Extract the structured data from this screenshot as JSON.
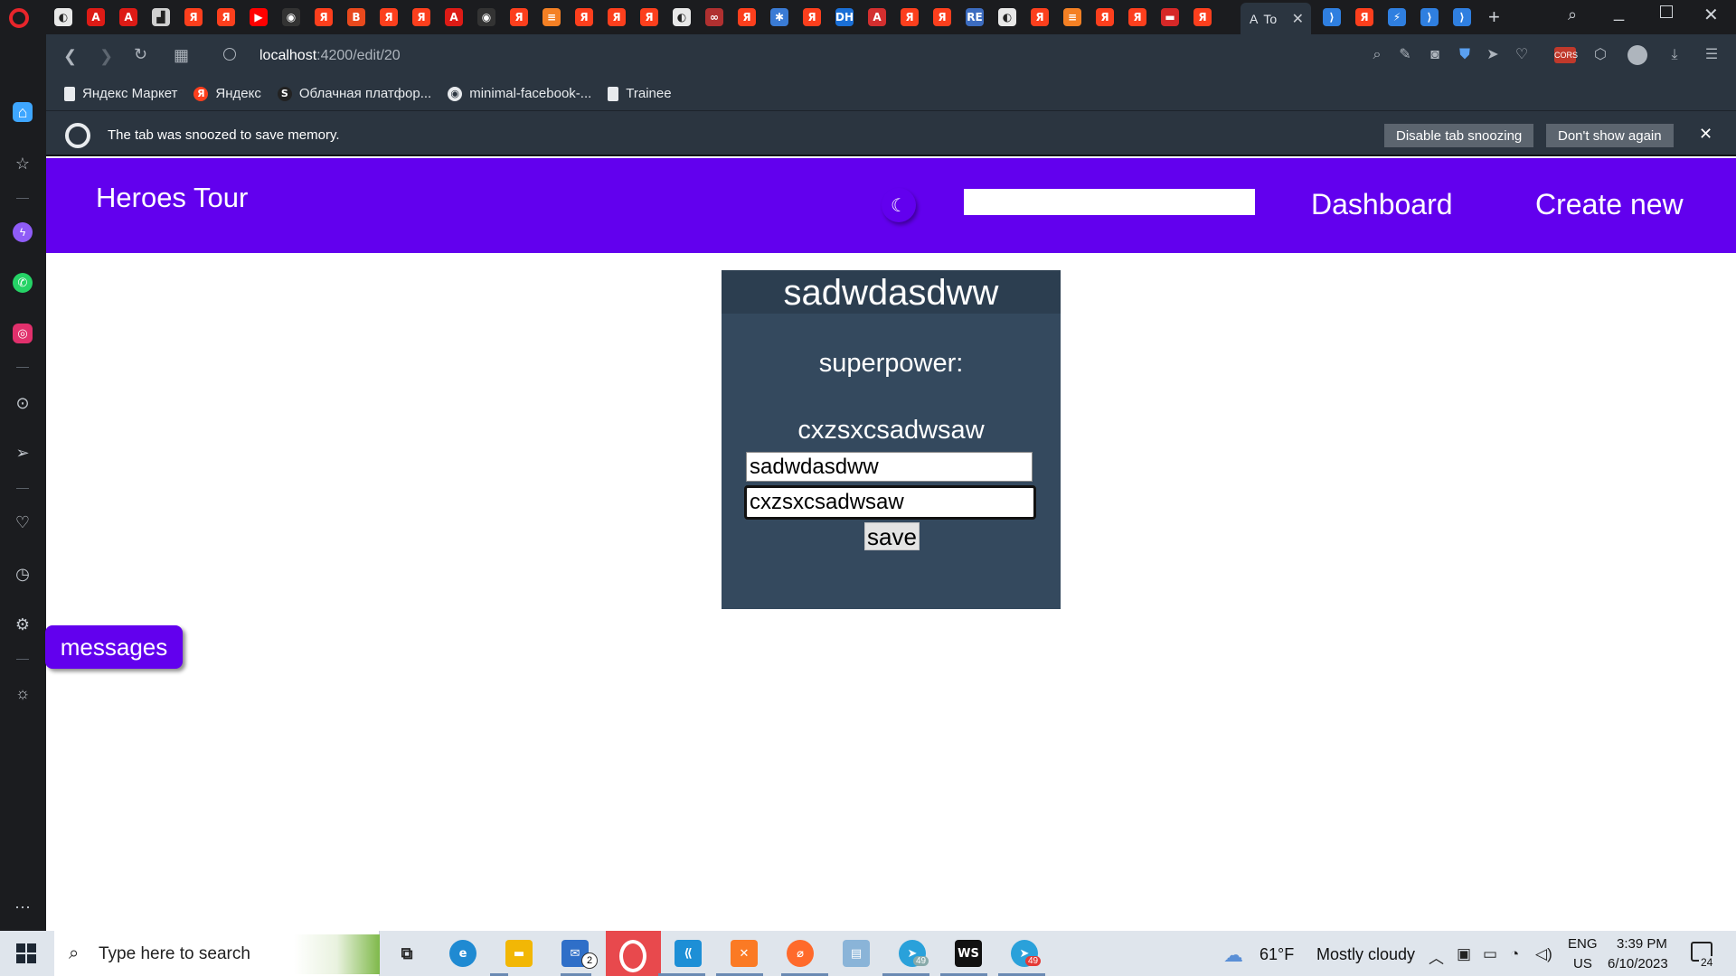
{
  "browser": {
    "tabs": [
      {
        "icon": "globe-icon",
        "color": "#e8e8e8",
        "glyph": "◐"
      },
      {
        "icon": "angular-icon",
        "color": "#dd1b16",
        "glyph": "A"
      },
      {
        "icon": "angular-icon",
        "color": "#dd1b16",
        "glyph": "A"
      },
      {
        "icon": "note-icon",
        "color": "#d0d0d0",
        "glyph": "▟"
      },
      {
        "icon": "yandex-icon",
        "color": "#fc3f1d",
        "glyph": "Я"
      },
      {
        "icon": "yandex-icon",
        "color": "#fc3f1d",
        "glyph": "Я"
      },
      {
        "icon": "youtube-icon",
        "color": "#ff0000",
        "glyph": "▶"
      },
      {
        "icon": "github-icon",
        "color": "#333333",
        "glyph": "◉"
      },
      {
        "icon": "yandex-icon",
        "color": "#fc3f1d",
        "glyph": "Я"
      },
      {
        "icon": "bold-icon",
        "color": "#e8491d",
        "glyph": "B"
      },
      {
        "icon": "yandex-icon",
        "color": "#fc3f1d",
        "glyph": "Я"
      },
      {
        "icon": "yandex-icon",
        "color": "#fc3f1d",
        "glyph": "Я"
      },
      {
        "icon": "angular-icon",
        "color": "#dd1b16",
        "glyph": "A"
      },
      {
        "icon": "github-icon",
        "color": "#333333",
        "glyph": "◉"
      },
      {
        "icon": "yandex-icon",
        "color": "#fc3f1d",
        "glyph": "Я"
      },
      {
        "icon": "stackoverflow-icon",
        "color": "#f48024",
        "glyph": "≡"
      },
      {
        "icon": "yandex-icon",
        "color": "#fc3f1d",
        "glyph": "Я"
      },
      {
        "icon": "yandex-icon",
        "color": "#fc3f1d",
        "glyph": "Я"
      },
      {
        "icon": "yandex-icon",
        "color": "#fc3f1d",
        "glyph": "Я"
      },
      {
        "icon": "globe-icon",
        "color": "#e8e8e8",
        "glyph": "◐"
      },
      {
        "icon": "infinity-icon",
        "color": "#b03030",
        "glyph": "∞"
      },
      {
        "icon": "yandex-icon",
        "color": "#fc3f1d",
        "glyph": "Я"
      },
      {
        "icon": "puzzle-icon",
        "color": "#3a7bd5",
        "glyph": "✱"
      },
      {
        "icon": "yandex-icon",
        "color": "#fc3f1d",
        "glyph": "Я"
      },
      {
        "icon": "dh-icon",
        "color": "#1a6fd6",
        "glyph": "DH"
      },
      {
        "icon": "pdf-icon",
        "color": "#d32f2f",
        "glyph": "A"
      },
      {
        "icon": "yandex-icon",
        "color": "#fc3f1d",
        "glyph": "Я"
      },
      {
        "icon": "yandex-icon",
        "color": "#fc3f1d",
        "glyph": "Я"
      },
      {
        "icon": "repo-icon",
        "color": "#3c6cc0",
        "glyph": "RE"
      },
      {
        "icon": "globe-icon",
        "color": "#e8e8e8",
        "glyph": "◐"
      },
      {
        "icon": "yandex-icon",
        "color": "#fc3f1d",
        "glyph": "Я"
      },
      {
        "icon": "stackoverflow-icon",
        "color": "#f48024",
        "glyph": "≡"
      },
      {
        "icon": "yandex-icon",
        "color": "#fc3f1d",
        "glyph": "Я"
      },
      {
        "icon": "yandex-icon",
        "color": "#fc3f1d",
        "glyph": "Я"
      },
      {
        "icon": "hud-icon",
        "color": "#d62828",
        "glyph": "▬"
      },
      {
        "icon": "yandex-icon",
        "color": "#fc3f1d",
        "glyph": "Я"
      }
    ],
    "active_tab": {
      "favicon": "A",
      "title": "To"
    },
    "tabs_after": [
      {
        "icon": "vscode-icon",
        "color": "#2f7fe0",
        "glyph": "⟩"
      },
      {
        "icon": "yandex-icon",
        "color": "#fc3f1d",
        "glyph": "Я"
      },
      {
        "icon": "bolt-icon",
        "color": "#2f7fe0",
        "glyph": "⚡"
      },
      {
        "icon": "vscode-icon",
        "color": "#2f7fe0",
        "glyph": "⟩"
      },
      {
        "icon": "vscode-icon",
        "color": "#2f7fe0",
        "glyph": "⟩"
      }
    ],
    "url_host": "localhost",
    "url_path": ":4200/edit/20",
    "bookmarks": [
      {
        "label": "Яндекс Маркет",
        "icon": "doc"
      },
      {
        "label": "Яндекс",
        "icon": "yandex"
      },
      {
        "label": "Облачная платфор...",
        "icon": "s"
      },
      {
        "label": "minimal-facebook-...",
        "icon": "github"
      },
      {
        "label": "Trainee",
        "icon": "doc"
      }
    ],
    "snooze": {
      "message": "The tab was snoozed to save memory.",
      "disable_label": "Disable tab snoozing",
      "dont_show_label": "Don't show again"
    }
  },
  "app": {
    "title": "Heroes Tour",
    "nav": {
      "dashboard": "Dashboard",
      "create": "Create new"
    },
    "hero": {
      "name": "sadwdasdww",
      "superpower_label": "superpower:",
      "superpower": "cxzsxcsadwsaw",
      "name_input_value": "sadwdasdww",
      "power_input_value": "cxzsxcsadwsaw",
      "save_label": "save"
    },
    "messages_label": "messages",
    "accent": "#6200ee",
    "card_color": "#34495e"
  },
  "taskbar": {
    "search_placeholder": "Type here to search",
    "mail_badge": "2",
    "telegram_badge_1": "49",
    "telegram_badge_2": "49",
    "weather_temp": "61°F",
    "weather_desc": "Mostly cloudy",
    "lang_1": "ENG",
    "lang_2": "US",
    "time": "3:39 PM",
    "date": "6/10/2023",
    "notification_count": "24"
  }
}
